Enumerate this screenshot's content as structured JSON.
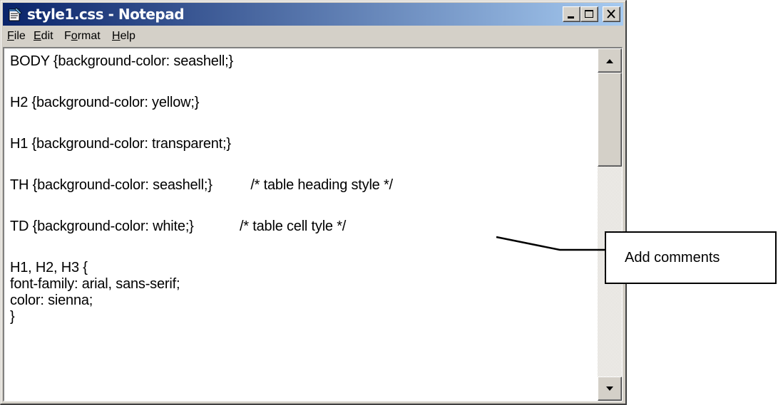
{
  "window": {
    "title": "style1.css - Notepad",
    "icon": "notepad-icon"
  },
  "menu": [
    {
      "label": "File",
      "mnemonic": "F",
      "rest": "ile"
    },
    {
      "label": "Edit",
      "mnemonic": "E",
      "rest": "dit"
    },
    {
      "label": "Format",
      "pre": "F",
      "mnemonic": "o",
      "rest": "rmat"
    },
    {
      "label": "Help",
      "mnemonic": "H",
      "rest": "elp"
    }
  ],
  "editor": {
    "lines": [
      "BODY {background-color: seashell;}",
      "",
      "H2 {background-color: yellow;}",
      "",
      "H1 {background-color: transparent;}",
      "",
      "TH {background-color: seashell;}          /* table heading style */",
      "",
      "TD {background-color: white;}            /* table cell tyle */",
      "",
      "H1, H2, H3 {",
      "font-family: arial, sans-serif;",
      "color: sienna;",
      "}"
    ]
  },
  "annotation": {
    "text": "Add comments"
  },
  "colors": {
    "title_start": "#0a246a",
    "title_end": "#a6caf0",
    "chrome": "#d4d0c8"
  }
}
